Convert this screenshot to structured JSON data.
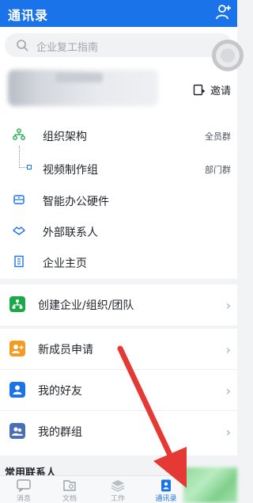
{
  "header": {
    "title": "通讯录"
  },
  "search": {
    "placeholder": "企业复工指南"
  },
  "org": {
    "invite_label": "邀请",
    "rows": [
      {
        "label": "组织架构",
        "tag": "全员群"
      },
      {
        "label": "视频制作组",
        "tag": "部门群"
      },
      {
        "label": "智能办公硬件",
        "tag": ""
      },
      {
        "label": "外部联系人",
        "tag": ""
      },
      {
        "label": "企业主页",
        "tag": ""
      }
    ]
  },
  "group1": {
    "items": [
      {
        "label": "创建企业/组织/团队"
      }
    ]
  },
  "group2": {
    "items": [
      {
        "label": "新成员申请"
      },
      {
        "label": "我的好友"
      },
      {
        "label": "我的群组"
      }
    ]
  },
  "frequent_contacts_title": "常用联系人",
  "tabs": [
    {
      "label": "消息",
      "icon": "message-icon"
    },
    {
      "label": "文档",
      "icon": "document-icon"
    },
    {
      "label": "工作",
      "icon": "workbench-icon"
    },
    {
      "label": "通讯录",
      "icon": "contacts-icon",
      "active": true
    },
    {
      "label": "",
      "icon": ""
    }
  ],
  "colors": {
    "brand": "#1a73e8",
    "orange": "#f59a23",
    "green": "#1fa84b",
    "red_arrow": "#e53935"
  }
}
